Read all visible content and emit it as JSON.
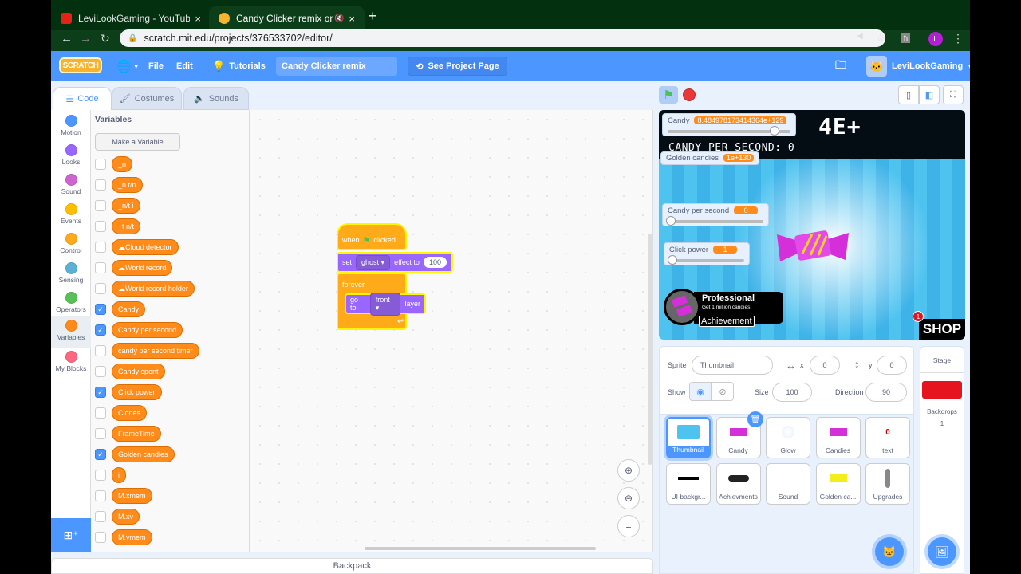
{
  "browser": {
    "tabs": [
      {
        "title": "LeviLookGaming - YouTube",
        "favicon": "youtube-icon",
        "active": false
      },
      {
        "title": "Candy Clicker remix on Scr",
        "favicon": "scratch-icon",
        "active": true
      }
    ],
    "new_tab": "+",
    "close": "×",
    "url": "scratch.mit.edu/projects/376533702/editor/",
    "profile_initial": "L",
    "colors": {
      "frame": "#03300f",
      "profile": "#b31fd2"
    }
  },
  "menubar": {
    "logo": "SCRATCH",
    "file": "File",
    "edit": "Edit",
    "tutorials": "Tutorials",
    "project_title": "Candy Clicker remix",
    "see_project_page": "See Project Page",
    "username": "LeviLookGaming",
    "colors": {
      "bar": "#4c97ff"
    }
  },
  "editor_tabs": {
    "code": "Code",
    "costumes": "Costumes",
    "sounds": "Sounds"
  },
  "categories": [
    {
      "label": "Motion",
      "color": "#4c97ff"
    },
    {
      "label": "Looks",
      "color": "#9966ff"
    },
    {
      "label": "Sound",
      "color": "#cf63cf"
    },
    {
      "label": "Events",
      "color": "#ffbf00"
    },
    {
      "label": "Control",
      "color": "#ffab19"
    },
    {
      "label": "Sensing",
      "color": "#5cb1d6"
    },
    {
      "label": "Operators",
      "color": "#59c059"
    },
    {
      "label": "Variables",
      "color": "#ff8c1a"
    },
    {
      "label": "My Blocks",
      "color": "#ff6680"
    }
  ],
  "palette": {
    "title": "Variables",
    "make_variable": "Make a Variable",
    "variables": [
      {
        "name": "_n",
        "checked": false,
        "cloud": false
      },
      {
        "name": "_n t/n",
        "checked": false,
        "cloud": false
      },
      {
        "name": "_n/t i",
        "checked": false,
        "cloud": false
      },
      {
        "name": "_t n/t",
        "checked": false,
        "cloud": false
      },
      {
        "name": "Cloud detector",
        "checked": false,
        "cloud": true
      },
      {
        "name": "World record",
        "checked": false,
        "cloud": true
      },
      {
        "name": "World record holder",
        "checked": false,
        "cloud": true
      },
      {
        "name": "Candy",
        "checked": true,
        "cloud": false
      },
      {
        "name": "Candy per second",
        "checked": true,
        "cloud": false
      },
      {
        "name": "candy per second timer",
        "checked": false,
        "cloud": false
      },
      {
        "name": "Candy spent",
        "checked": false,
        "cloud": false
      },
      {
        "name": "Click power",
        "checked": true,
        "cloud": false
      },
      {
        "name": "Clones",
        "checked": false,
        "cloud": false
      },
      {
        "name": "FrameTime",
        "checked": false,
        "cloud": false
      },
      {
        "name": "Golden candies",
        "checked": true,
        "cloud": false
      },
      {
        "name": "i",
        "checked": false,
        "cloud": false
      },
      {
        "name": "M.xmem",
        "checked": false,
        "cloud": false
      },
      {
        "name": "M.xv",
        "checked": false,
        "cloud": false
      },
      {
        "name": "M.ymem",
        "checked": false,
        "cloud": false
      }
    ]
  },
  "script": {
    "hat": {
      "when": "when",
      "clicked": "clicked"
    },
    "set_effect": {
      "set": "set",
      "effect": "ghost",
      "to": "effect to",
      "value": "100"
    },
    "forever": "forever",
    "go_to_layer": {
      "go_to": "go to",
      "layer_opt": "front",
      "layer": "layer"
    }
  },
  "backpack": "Backpack",
  "stage": {
    "big_text": "4E+",
    "candy_per_second_text": "CANDY PER SECOND: 0",
    "monitors": {
      "candy": {
        "label": "Candy",
        "value": "8.484978173414364e+129"
      },
      "golden": {
        "label": "Golden candies",
        "value": "1e+130"
      },
      "cps": {
        "label": "Candy per second",
        "value": "0"
      },
      "click_power": {
        "label": "Click power",
        "value": "1"
      }
    },
    "achievement": {
      "title": "Professional",
      "subtitle": "Get 1 million candies",
      "tag": "Achievement"
    },
    "shop": "SHOP",
    "shop_badge": "1"
  },
  "sprite_info": {
    "sprite_label": "Sprite",
    "sprite_name": "Thumbnail",
    "x_label": "x",
    "x": "0",
    "y_label": "y",
    "y": "0",
    "show_label": "Show",
    "size_label": "Size",
    "size": "100",
    "direction_label": "Direction",
    "direction": "90"
  },
  "sprites": [
    {
      "name": "Thumbnail",
      "selected": true
    },
    {
      "name": "Candy",
      "selected": false
    },
    {
      "name": "Glow",
      "selected": false
    },
    {
      "name": "Candies",
      "selected": false
    },
    {
      "name": "text",
      "selected": false
    },
    {
      "name": "UI backgr...",
      "selected": false
    },
    {
      "name": "Achievments",
      "selected": false
    },
    {
      "name": "Sound",
      "selected": false
    },
    {
      "name": "Golden ca...",
      "selected": false
    },
    {
      "name": "Upgrades",
      "selected": false
    }
  ],
  "stage_pane": {
    "title": "Stage",
    "backdrops_label": "Backdrops",
    "backdrops_count": "1",
    "backdrop_color": "#e5141e"
  }
}
